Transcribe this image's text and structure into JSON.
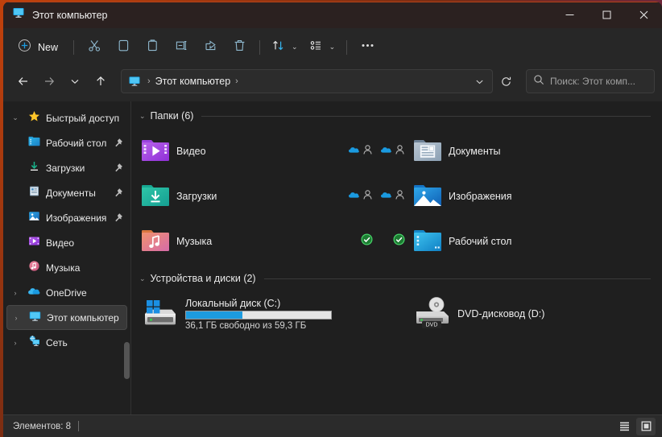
{
  "window": {
    "title": "Этот компьютер",
    "title_icon": "this-pc-icon",
    "minimize_label": "—",
    "maximize_label": "□",
    "close_label": "✕",
    "accent_color": "#1d9bdf",
    "titlebar_color": "#2b2120"
  },
  "toolbar": {
    "new_label": "New",
    "new_icon": "plus-circle-icon",
    "cut_icon": "scissors-icon",
    "copy_icon": "copy-icon",
    "paste_icon": "paste-icon",
    "rename_icon": "rename-icon",
    "share_icon": "share-icon",
    "delete_icon": "trash-icon",
    "sort_icon": "sort-arrows-icon",
    "view_icon": "view-list-icon",
    "more_icon": "ellipsis-icon",
    "caret": "⌄"
  },
  "nav": {
    "back_icon": "arrow-left-icon",
    "forward_icon": "arrow-right-icon",
    "recent_icon": "chevron-down-icon",
    "up_icon": "arrow-up-icon",
    "breadcrumb_icon": "this-pc-icon",
    "breadcrumb_text": "Этот компьютер",
    "breadcrumb_sep": "›",
    "dropdown_icon": "chevron-down-icon",
    "refresh_icon": "refresh-icon"
  },
  "search": {
    "icon": "search-icon",
    "placeholder": "Поиск: Этот комп..."
  },
  "sidebar": {
    "items": [
      {
        "label": "Быстрый доступ",
        "icon": "star-icon",
        "chevron": "⌄",
        "expanded": true,
        "indent": false,
        "pinned": false,
        "selected": false
      },
      {
        "label": "Рабочий стол",
        "icon": "desktop-folder-icon",
        "chevron": "",
        "expanded": false,
        "indent": true,
        "pinned": true,
        "selected": false
      },
      {
        "label": "Загрузки",
        "icon": "downloads-icon",
        "chevron": "",
        "expanded": false,
        "indent": true,
        "pinned": true,
        "selected": false
      },
      {
        "label": "Документы",
        "icon": "documents-icon",
        "chevron": "",
        "expanded": false,
        "indent": true,
        "pinned": true,
        "selected": false
      },
      {
        "label": "Изображения",
        "icon": "pictures-icon",
        "chevron": "",
        "expanded": false,
        "indent": true,
        "pinned": true,
        "selected": false
      },
      {
        "label": "Видео",
        "icon": "videos-icon",
        "chevron": "",
        "expanded": false,
        "indent": true,
        "pinned": false,
        "selected": false
      },
      {
        "label": "Музыка",
        "icon": "music-icon",
        "chevron": "",
        "expanded": false,
        "indent": true,
        "pinned": false,
        "selected": false
      },
      {
        "label": "OneDrive",
        "icon": "cloud-icon",
        "chevron": "›",
        "expanded": false,
        "indent": false,
        "pinned": false,
        "selected": false
      },
      {
        "label": "Этот компьютер",
        "icon": "this-pc-icon",
        "chevron": "›",
        "expanded": false,
        "indent": false,
        "pinned": false,
        "selected": true
      },
      {
        "label": "Сеть",
        "icon": "network-icon",
        "chevron": "›",
        "expanded": false,
        "indent": false,
        "pinned": false,
        "selected": false
      }
    ]
  },
  "content": {
    "sections": [
      {
        "title": "Папки (6)",
        "chevron": "⌄",
        "items": [
          {
            "label": "Видео",
            "icon": "videos-folder-icon",
            "badge": "none",
            "column": 1
          },
          {
            "label": "Документы",
            "icon": "documents-folder-icon",
            "badge": "cloud-person",
            "column": 2
          },
          {
            "label": "Загрузки",
            "icon": "downloads-folder-icon",
            "badge": "none",
            "column": 1
          },
          {
            "label": "Изображения",
            "icon": "pictures-folder-icon",
            "badge": "cloud-person",
            "column": 2
          },
          {
            "label": "Музыка",
            "icon": "music-folder-icon",
            "badge": "none",
            "column": 1
          },
          {
            "label": "Рабочий стол",
            "icon": "desktop-folder-icon",
            "badge": "check-green",
            "column": 2
          }
        ],
        "left_badges": [
          {
            "for": "Видео",
            "badge": "cloud-person"
          },
          {
            "for": "Загрузки",
            "badge": "cloud-person"
          },
          {
            "for": "Музыка",
            "badge": "check-green"
          }
        ]
      },
      {
        "title": "Устройства и диски (2)",
        "chevron": "⌄",
        "drives": [
          {
            "name": "Локальный диск (C:)",
            "icon": "hdd-windows-icon",
            "free_text": "36,1 ГБ свободно из 59,3 ГБ",
            "used_percent": 39,
            "bar_fill_color": "#1d9bdf",
            "bar_track_color": "#e4e4e4",
            "column": 1
          },
          {
            "name": "DVD-дисковод (D:)",
            "icon": "dvd-drive-icon",
            "icon_tag": "DVD",
            "free_text": "",
            "used_percent": null,
            "column": 2
          }
        ]
      }
    ]
  },
  "status": {
    "items_text": "Элементов: 8",
    "details_view_icon": "details-view-icon",
    "large_icons_view_icon": "large-icons-view-icon"
  }
}
